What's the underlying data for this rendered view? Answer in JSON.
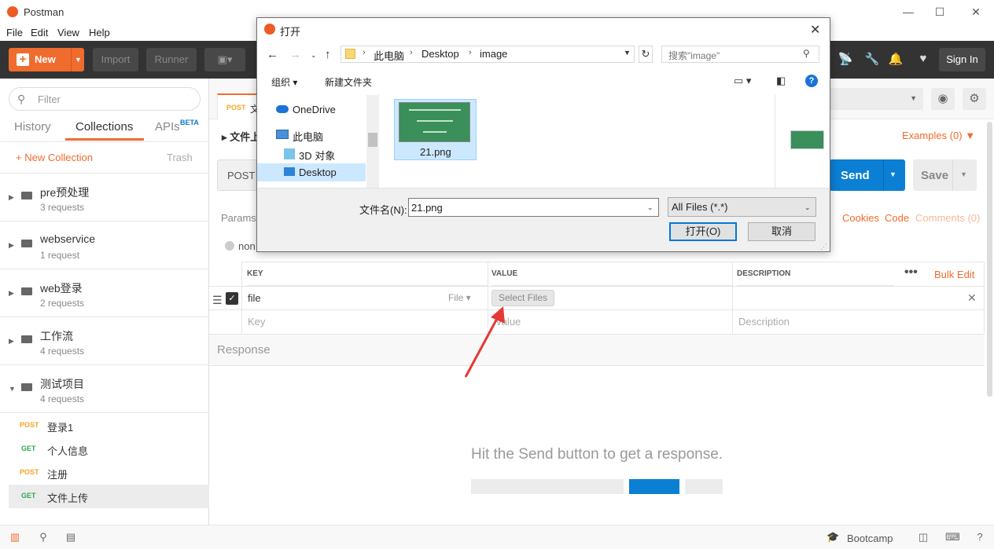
{
  "window": {
    "title": "Postman"
  },
  "menu": [
    "File",
    "Edit",
    "View",
    "Help"
  ],
  "toolbar": {
    "new_label": "New",
    "import_label": "Import",
    "runner_label": "Runner",
    "signin_label": "Sign In"
  },
  "sidebar": {
    "filter_placeholder": "Filter",
    "tabs": [
      "History",
      "Collections",
      "APIs"
    ],
    "beta": "BETA",
    "new_collection": "New Collection",
    "trash": "Trash",
    "collections": [
      {
        "name": "pre预处理",
        "count": "3 requests"
      },
      {
        "name": "webservice",
        "count": "1 request"
      },
      {
        "name": "web登录",
        "count": "2 requests"
      },
      {
        "name": "工作流",
        "count": "4 requests"
      },
      {
        "name": "测试项目",
        "count": "4 requests"
      }
    ],
    "requests": [
      {
        "method": "POST",
        "name": "登录1",
        "color": "#f4a623"
      },
      {
        "method": "GET",
        "name": "个人信息",
        "color": "#2fa84f"
      },
      {
        "method": "POST",
        "name": "注册",
        "color": "#f4a623"
      },
      {
        "method": "GET",
        "name": "文件上传",
        "color": "#2fa84f"
      }
    ]
  },
  "main": {
    "tab_method": "POST",
    "tab_title": "文",
    "request_name": "文件上",
    "examples": "Examples (0)",
    "url_method": "POST",
    "send_label": "Send",
    "save_label": "Save",
    "params_label": "Params",
    "cookies_label": "Cookies",
    "code_label": "Code",
    "comments_label": "Comments (0)",
    "body_radio": "non",
    "table": {
      "headers": [
        "KEY",
        "VALUE",
        "DESCRIPTION"
      ],
      "bulk_edit": "Bulk Edit",
      "row_key": "file",
      "row_type": "File",
      "select_files": "Select Files",
      "key_placeholder": "Key",
      "value_placeholder": "Value",
      "desc_placeholder": "Description"
    },
    "response_label": "Response",
    "hint": "Hit the Send button to get a response."
  },
  "statusbar": {
    "bootcamp": "Bootcamp"
  },
  "dialog": {
    "title": "打开",
    "path": [
      "此电脑",
      "Desktop",
      "image"
    ],
    "search_placeholder": "搜索\"image\"",
    "organize": "组织",
    "new_folder": "新建文件夹",
    "nav_items": [
      "OneDrive",
      "此电脑",
      "3D 对象",
      "Desktop"
    ],
    "file_name": "21.png",
    "filename_label": "文件名(N):",
    "filename_value": "21.png",
    "file_type": "All Files (*.*)",
    "open_label": "打开(O)",
    "cancel_label": "取消"
  }
}
